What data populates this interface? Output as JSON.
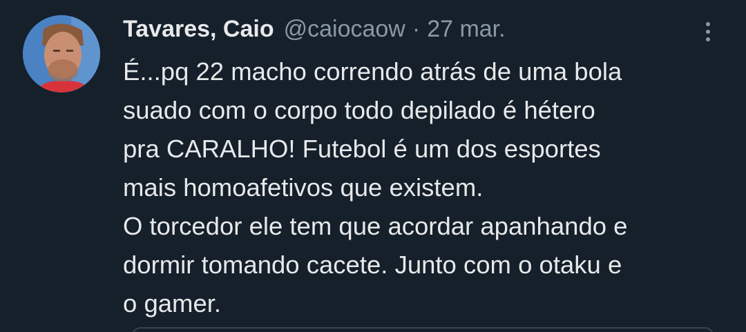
{
  "tweet": {
    "author_name": "Tavares, Caio",
    "author_handle": "@caiocaow",
    "separator": "·",
    "date": "27 mar.",
    "body_lines": [
      "É...pq 22 macho correndo atrás de uma bola",
      "suado com o corpo todo depilado é hétero",
      "pra CARALHO! Futebol é um dos esportes",
      "mais homoafetivos que existem.",
      "O torcedor ele tem que acordar apanhando e",
      "dormir tomando cacete. Junto com o otaku e",
      "o gamer."
    ],
    "more_icon": "more-vertical-icon"
  },
  "colors": {
    "background": "#15202b",
    "text_primary": "#e7e9ea",
    "text_secondary": "#8b98a5",
    "border": "#38444d"
  }
}
